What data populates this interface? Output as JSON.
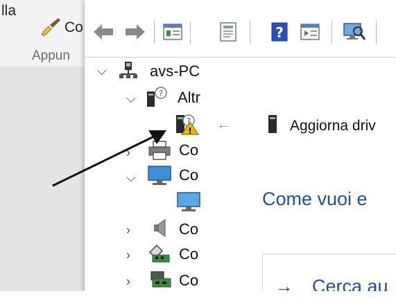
{
  "ribbon": {
    "partial_label_top": "lla",
    "clean_label": "Co",
    "group_label": "Appun"
  },
  "device_manager": {
    "toolbar": {
      "back_icon": "arrow-left-icon",
      "forward_icon": "arrow-right-icon",
      "buttons": [
        "properties-icon",
        "update-icon",
        "help-icon",
        "view-icon",
        "scan-hardware-icon"
      ]
    },
    "tree": {
      "computer": "avs-PC",
      "other_devices": "Altr",
      "unknown_device_status": "warning",
      "items": [
        {
          "label": "Co",
          "icon": "printer-icon",
          "expanded": false
        },
        {
          "label": "Co",
          "icon": "monitor-icon",
          "expanded": true
        },
        {
          "label": "Co",
          "icon": "speaker-icon",
          "expanded": false
        },
        {
          "label": "Co",
          "icon": "controller-icon",
          "expanded": false
        },
        {
          "label": "Co",
          "icon": "network-card-icon",
          "expanded": false
        }
      ]
    }
  },
  "dialog": {
    "back_icon": "arrow-left-icon",
    "title": "Aggiorna driv",
    "heading": "Come vuoi e",
    "option_arrow": "→",
    "option_label": "Cerca au"
  },
  "colors": {
    "accent_blue": "#1f4fa3",
    "warning_yellow": "#f2b600"
  }
}
